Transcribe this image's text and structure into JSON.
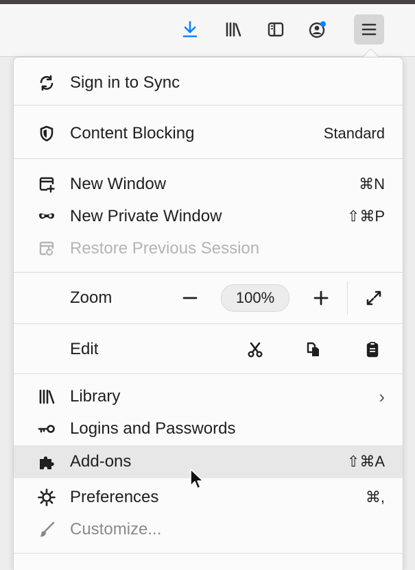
{
  "toolbar": {
    "buttons": [
      {
        "icon": "download-arrow-icon",
        "color": "#0a84ff"
      },
      {
        "icon": "library-icon"
      },
      {
        "icon": "sidebar-icon"
      },
      {
        "icon": "account-icon"
      },
      {
        "icon": "hamburger-menu-icon",
        "active": true
      }
    ]
  },
  "menu": {
    "sync": {
      "label": "Sign in to Sync",
      "icon": "sync-icon"
    },
    "content_blocking": {
      "label": "Content Blocking",
      "value": "Standard",
      "icon": "shield-icon"
    },
    "new_window": {
      "label": "New Window",
      "shortcut": "⌘N",
      "icon": "new-window-icon"
    },
    "new_private_window": {
      "label": "New Private Window",
      "shortcut": "⇧⌘P",
      "icon": "private-mask-icon"
    },
    "restore_session": {
      "label": "Restore Previous Session",
      "icon": "restore-session-icon",
      "disabled": true
    },
    "zoom": {
      "label": "Zoom",
      "value": "100%",
      "minus": "−",
      "plus": "+"
    },
    "edit": {
      "label": "Edit"
    },
    "library": {
      "label": "Library",
      "icon": "library-icon",
      "chevron": "›"
    },
    "logins": {
      "label": "Logins and Passwords",
      "icon": "key-icon"
    },
    "addons": {
      "label": "Add-ons",
      "shortcut": "⇧⌘A",
      "icon": "puzzle-icon",
      "hovered": true
    },
    "preferences": {
      "label": "Preferences",
      "shortcut": "⌘,",
      "icon": "gear-icon"
    },
    "customize": {
      "label": "Customize...",
      "icon": "brush-icon"
    }
  },
  "colors": {
    "accent": "#0a84ff",
    "hover": "#e7e7e7",
    "disabled": "#b4b4b4"
  }
}
